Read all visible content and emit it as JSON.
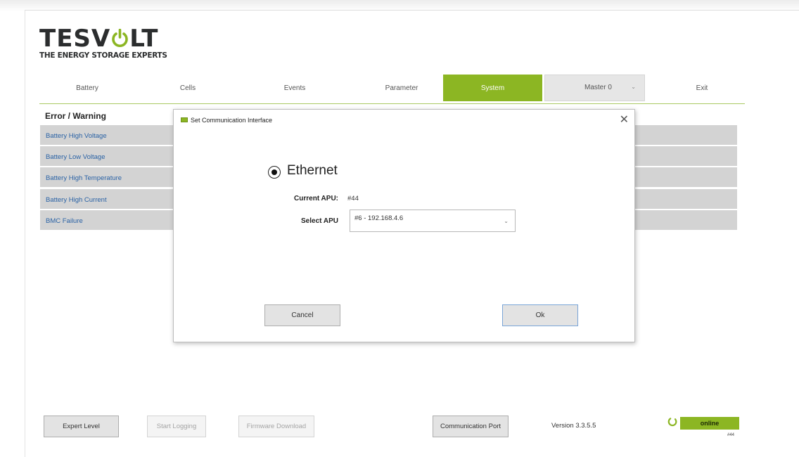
{
  "logo": {
    "word_left": "TESV",
    "word_right": "LT",
    "tagline": "THE ENERGY STORAGE EXPERTS"
  },
  "nav": {
    "items": [
      "Battery",
      "Cells",
      "Events",
      "Parameter",
      "System"
    ],
    "active": "System",
    "master_select": "Master 0",
    "exit": "Exit"
  },
  "error_warning": {
    "title": "Error / Warning",
    "rows": [
      "Battery High Voltage",
      "Battery Low Voltage",
      "Battery High Temperature",
      "Battery High Current",
      "BMC Failure"
    ]
  },
  "dialog": {
    "title": "Set Communication Interface",
    "option_label": "Ethernet",
    "current_apu_label": "Current APU:",
    "current_apu_value": "#44",
    "select_apu_label": "Select APU",
    "select_apu_value": "#6 - 192.168.4.6",
    "cancel_label": "Cancel",
    "ok_label": "Ok"
  },
  "footer": {
    "expert_level": "Expert Level",
    "start_logging": "Start Logging",
    "firmware_download": "Firmware Download",
    "communication_port": "Communication Port",
    "version": "Version 3.3.5.5",
    "status": "online",
    "status_id": "#44"
  },
  "colors": {
    "accent_green": "#8cb623",
    "link_blue": "#2a62a5",
    "row_grey": "#d3d3d3"
  }
}
